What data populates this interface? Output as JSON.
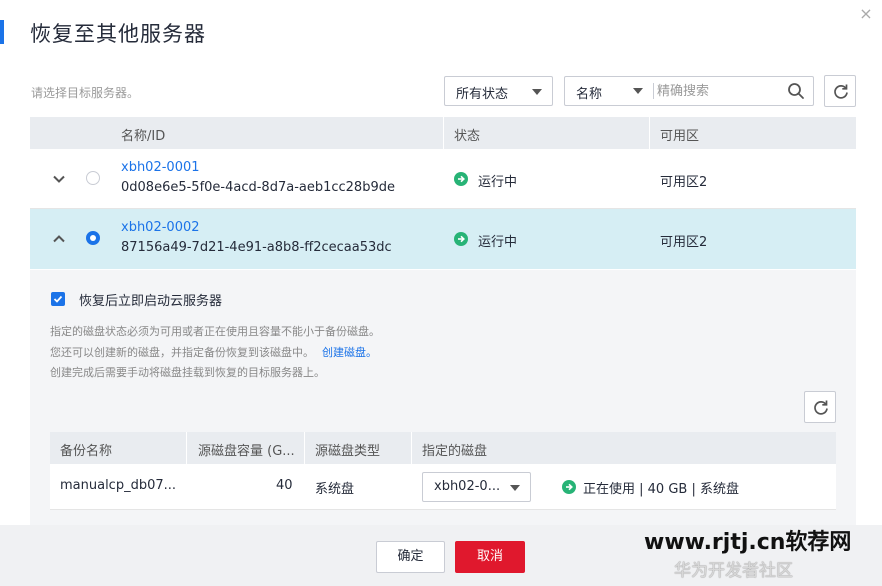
{
  "dialog": {
    "title": "恢复至其他服务器",
    "close_label": "×"
  },
  "filter": {
    "hint": "请选择目标服务器。",
    "status_select": "所有状态",
    "field_select": "名称",
    "search_placeholder": "精确搜索"
  },
  "table": {
    "columns": [
      "名称/ID",
      "状态",
      "可用区"
    ],
    "rows": [
      {
        "name": "xbh02-0001",
        "id": "0d08e6e5-5f0e-4acd-8d7a-aeb1cc28b9de",
        "status": "运行中",
        "zone": "可用区2",
        "selected": false
      },
      {
        "name": "xbh02-0002",
        "id": "87156a49-7d21-4e91-a8b8-ff2cecaa53dc",
        "status": "运行中",
        "zone": "可用区2",
        "selected": true
      }
    ]
  },
  "restore": {
    "start_after_restore": "恢复后立即启动云服务器",
    "notes": [
      "指定的磁盘状态必须为可用或者正在使用且容量不能小于备份磁盘。",
      "您还可以创建新的磁盘，并指定备份恢复到该磁盘中。",
      "创建完成后需要手动将磁盘挂载到恢复的目标服务器上。"
    ],
    "create_disk_link": "创建磁盘。"
  },
  "disk_table": {
    "columns": [
      "备份名称",
      "源磁盘容量 (G...",
      "源磁盘类型",
      "指定的磁盘"
    ],
    "rows": [
      {
        "backup_name": "manualcp_db07...",
        "capacity": "40",
        "type": "系统盘",
        "target_disk": "xbh02-0...",
        "target_status": "正在使用 | 40 GB | 系统盘"
      }
    ]
  },
  "footer": {
    "ok_label": "确定",
    "cancel_label": "取消"
  },
  "watermark": {
    "url": "www.rjtj.cn软荐网",
    "weibo": "华为开发者社区"
  },
  "colors": {
    "accent": "#1b73e8",
    "selected_row": "#d6eef4",
    "running": "#27b376",
    "danger": "#e0182d"
  }
}
